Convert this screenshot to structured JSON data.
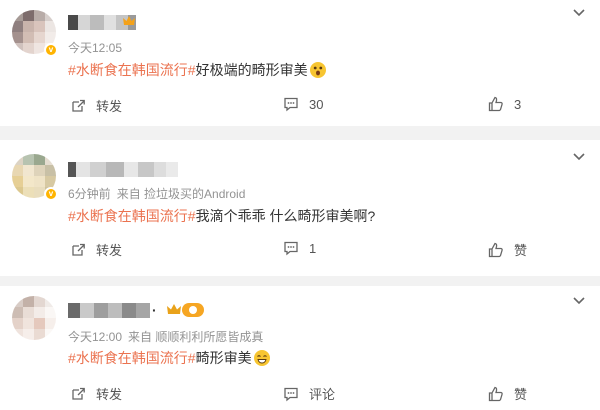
{
  "posts": [
    {
      "time": "今天12:05",
      "source": "",
      "hashtag": "#水断食在韩国流行#",
      "text": "好极端的畸形审美",
      "repost_label": "转发",
      "comment_count": "30",
      "like_count": "3"
    },
    {
      "time": "6分钟前",
      "source": "来自 捡垃圾买的Android",
      "hashtag": "#水断食在韩国流行#",
      "text": "我滴个乖乖 什么畸形审美啊?",
      "repost_label": "转发",
      "comment_count": "1",
      "like_count": "赞"
    },
    {
      "name_suffix": "·",
      "time": "今天12:00",
      "source": "来自 顺顺利利所愿皆成真",
      "hashtag": "#水断食在韩国流行#",
      "text": "畸形审美",
      "repost_label": "转发",
      "comment_count": "评论",
      "like_count": "赞"
    }
  ],
  "colors": {
    "hashtag": "#eb7350",
    "meta": "#939393",
    "separator": "#f2f2f2",
    "verified_badge": "#ffb400"
  }
}
